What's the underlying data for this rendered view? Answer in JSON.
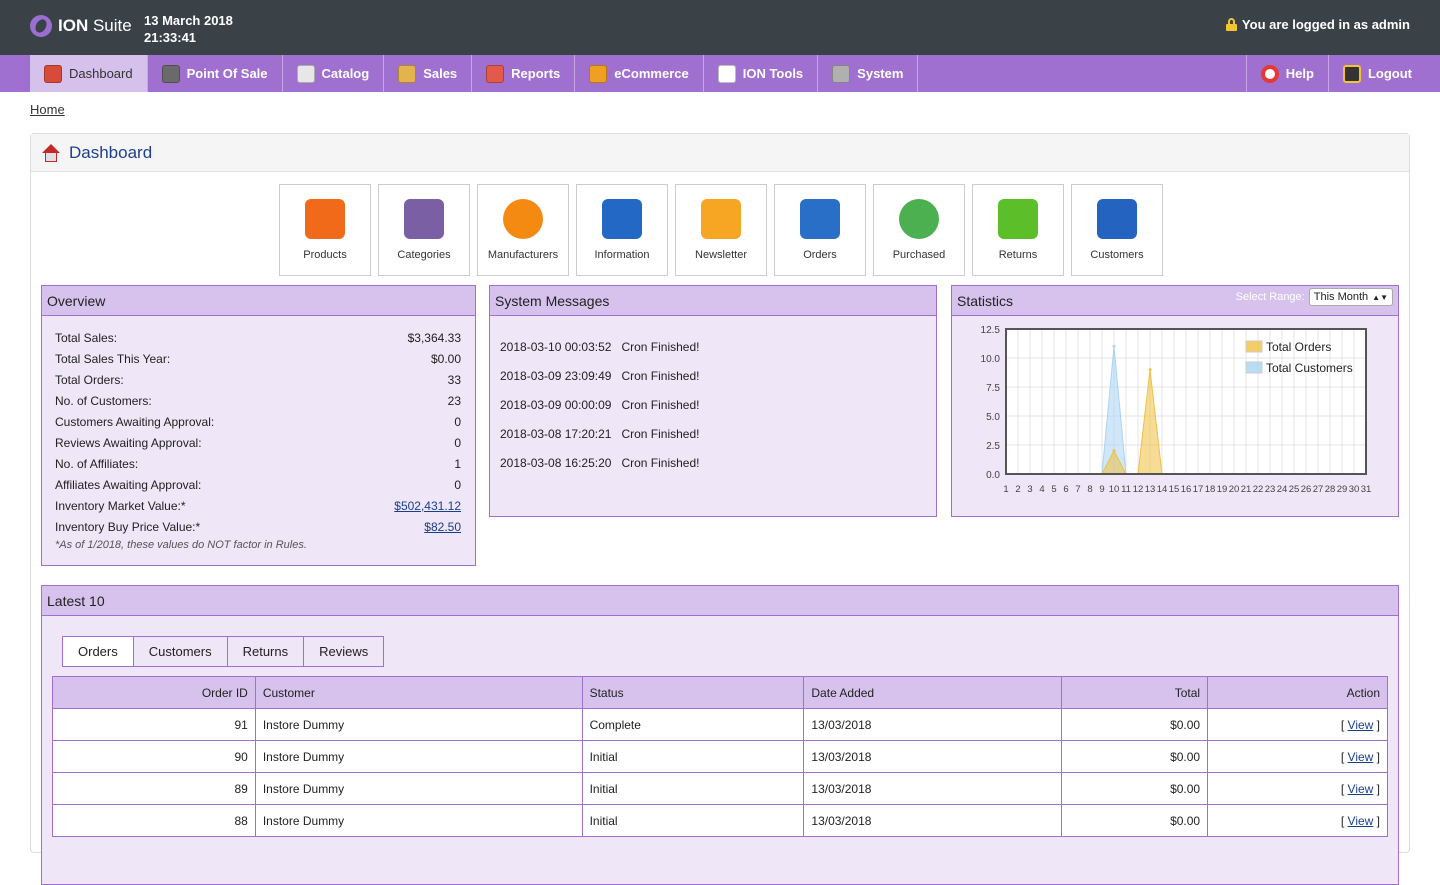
{
  "header": {
    "logo_bold": "ION",
    "logo_rest": " Suite",
    "date": "13 March 2018",
    "time": "21:33:41",
    "login_text": "You are logged in as admin"
  },
  "nav": {
    "items": [
      {
        "label": "Dashboard",
        "icon": "house-icon",
        "color": "#d84a3a"
      },
      {
        "label": "Point Of Sale",
        "icon": "cash-register-icon",
        "color": "#6a6a6a"
      },
      {
        "label": "Catalog",
        "icon": "catalog-icon",
        "color": "#e7e7e7"
      },
      {
        "label": "Sales",
        "icon": "clipboard-icon",
        "color": "#e3b34d"
      },
      {
        "label": "Reports",
        "icon": "presentation-icon",
        "color": "#e35a4a"
      },
      {
        "label": "eCommerce",
        "icon": "palette-icon",
        "color": "#f0a020"
      },
      {
        "label": "ION Tools",
        "icon": "ion-logo-icon",
        "color": "#ffffff"
      },
      {
        "label": "System",
        "icon": "tools-icon",
        "color": "#b0b0b0"
      }
    ],
    "help": "Help",
    "logout": "Logout"
  },
  "breadcrumb": "Home",
  "page_title": "Dashboard",
  "tiles": [
    {
      "label": "Products",
      "icon": "products-icon",
      "color": "#f06a1a"
    },
    {
      "label": "Categories",
      "icon": "categories-icon",
      "color": "#7a5fa5"
    },
    {
      "label": "Manufacturers",
      "icon": "orange-fruit-icon",
      "color": "#f58a12"
    },
    {
      "label": "Information",
      "icon": "info-icon",
      "color": "#2368c4"
    },
    {
      "label": "Newsletter",
      "icon": "envelope-icon",
      "color": "#f6a623"
    },
    {
      "label": "Orders",
      "icon": "printer-icon",
      "color": "#2a6fc7"
    },
    {
      "label": "Purchased",
      "icon": "pie-chart-icon",
      "color": "#4caf50"
    },
    {
      "label": "Returns",
      "icon": "return-arrow-icon",
      "color": "#5cbf2a"
    },
    {
      "label": "Customers",
      "icon": "users-icon",
      "color": "#2563c0"
    }
  ],
  "overview": {
    "title": "Overview",
    "rows": [
      {
        "label": "Total Sales:",
        "value": "$3,364.33"
      },
      {
        "label": "Total Sales This Year:",
        "value": "$0.00"
      },
      {
        "label": "Total Orders:",
        "value": "33"
      },
      {
        "label": "No. of Customers:",
        "value": "23"
      },
      {
        "label": "Customers Awaiting Approval:",
        "value": "0"
      },
      {
        "label": "Reviews Awaiting Approval:",
        "value": "0"
      },
      {
        "label": "No. of Affiliates:",
        "value": "1"
      },
      {
        "label": "Affiliates Awaiting Approval:",
        "value": "0"
      },
      {
        "label": "Inventory Market Value:*",
        "value": "$502,431.12"
      },
      {
        "label": "Inventory Buy Price Value:*",
        "value": "$82.50"
      }
    ],
    "note": "*As of 1/2018, these values do NOT factor in Rules."
  },
  "messages": {
    "title": "System Messages",
    "items": [
      {
        "time": "2018-03-10 00:03:52",
        "text": "Cron Finished!"
      },
      {
        "time": "2018-03-09 23:09:49",
        "text": "Cron Finished!"
      },
      {
        "time": "2018-03-09 00:00:09",
        "text": "Cron Finished!"
      },
      {
        "time": "2018-03-08 17:20:21",
        "text": "Cron Finished!"
      },
      {
        "time": "2018-03-08 16:25:20",
        "text": "Cron Finished!"
      }
    ]
  },
  "statistics": {
    "title": "Statistics",
    "range_label": "Select Range:",
    "range_value": "This Month"
  },
  "chart_data": {
    "type": "area",
    "x": [
      1,
      2,
      3,
      4,
      5,
      6,
      7,
      8,
      9,
      10,
      11,
      12,
      13,
      14,
      15,
      16,
      17,
      18,
      19,
      20,
      21,
      22,
      23,
      24,
      25,
      26,
      27,
      28,
      29,
      30,
      31
    ],
    "yticks": [
      "0.0",
      "2.5",
      "5.0",
      "7.5",
      "10.0",
      "12.5"
    ],
    "ylim": [
      0,
      12.5
    ],
    "series": [
      {
        "name": "Total Orders",
        "color": "#f0c040",
        "values": [
          0,
          0,
          0,
          0,
          0,
          0,
          0,
          0,
          0,
          2,
          0,
          0,
          9,
          0,
          0,
          0,
          0,
          0,
          0,
          0,
          0,
          0,
          0,
          0,
          0,
          0,
          0,
          0,
          0,
          0,
          0
        ]
      },
      {
        "name": "Total Customers",
        "color": "#a8d4f2",
        "values": [
          0,
          0,
          0,
          0,
          0,
          0,
          0,
          0,
          0,
          11,
          0,
          0,
          0,
          0,
          0,
          0,
          0,
          0,
          0,
          0,
          0,
          0,
          0,
          0,
          0,
          0,
          0,
          0,
          0,
          0,
          0
        ]
      }
    ],
    "legend": "top-right",
    "grid": true
  },
  "latest": {
    "title": "Latest 10",
    "tabs": [
      "Orders",
      "Customers",
      "Returns",
      "Reviews"
    ],
    "columns": [
      "Order ID",
      "Customer",
      "Status",
      "Date Added",
      "Total",
      "Action"
    ],
    "rows": [
      {
        "id": "91",
        "customer": "Instore Dummy",
        "status": "Complete",
        "date": "13/03/2018",
        "total": "$0.00",
        "action": "View"
      },
      {
        "id": "90",
        "customer": "Instore Dummy",
        "status": "Initial",
        "date": "13/03/2018",
        "total": "$0.00",
        "action": "View"
      },
      {
        "id": "89",
        "customer": "Instore Dummy",
        "status": "Initial",
        "date": "13/03/2018",
        "total": "$0.00",
        "action": "View"
      },
      {
        "id": "88",
        "customer": "Instore Dummy",
        "status": "Initial",
        "date": "13/03/2018",
        "total": "$0.00",
        "action": "View"
      }
    ]
  }
}
